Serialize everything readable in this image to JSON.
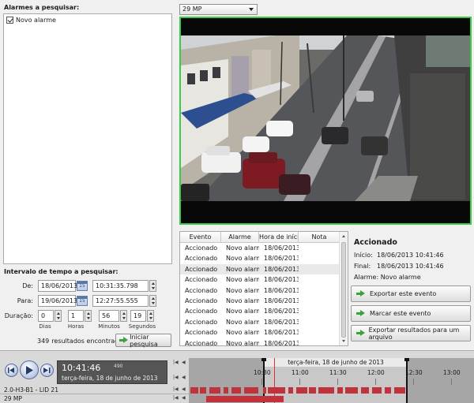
{
  "search": {
    "alarms_title": "Alarmes a pesquisar:",
    "alarms": [
      {
        "label": "Novo alarme",
        "checked": true
      }
    ],
    "interval_title": "Intervalo de tempo a pesquisar:",
    "from_label": "De:",
    "from_date": "18/06/2013",
    "from_time": "10:31:35.798",
    "to_label": "Para:",
    "to_date": "19/06/2013",
    "to_time": "12:27:55.555",
    "duration_label": "Duração:",
    "duration": {
      "days": "0",
      "hours": "1",
      "minutes": "56",
      "seconds": "19"
    },
    "units": {
      "days": "Dias",
      "hours": "Horas",
      "minutes": "Minutos",
      "seconds": "Segundos"
    },
    "results_count": "349",
    "results_label": "resultados encontrados",
    "start_search_label": "Iniciar pesquisa",
    "calendar_icon_text": "15"
  },
  "camera": {
    "selected": "29 MP"
  },
  "events_table": {
    "headers": [
      "Evento",
      "Alarme",
      "Hora de início",
      "Nota"
    ],
    "rows": [
      [
        "Accionado",
        "Novo alarm",
        "18/06/2013",
        ""
      ],
      [
        "Accionado",
        "Novo alarm",
        "18/06/2013",
        ""
      ],
      [
        "Accionado",
        "Novo alarm",
        "18/06/2013",
        ""
      ],
      [
        "Accionado",
        "Novo alarm",
        "18/06/2013",
        ""
      ],
      [
        "Accionado",
        "Novo alarm",
        "18/06/2013",
        ""
      ],
      [
        "Accionado",
        "Novo alarm",
        "18/06/2013",
        ""
      ],
      [
        "Accionado",
        "Novo alarm",
        "18/06/2013",
        ""
      ],
      [
        "Accionado",
        "Novo alarm",
        "18/06/2013",
        ""
      ],
      [
        "Accionado",
        "Novo alarm",
        "18/06/2013",
        ""
      ],
      [
        "Accionado",
        "Novo alarm",
        "18/06/2013",
        ""
      ]
    ],
    "selected_row": 2
  },
  "detail": {
    "title": "Accionado",
    "start_label": "Início:",
    "start_value": "18/06/2013 10:41:46",
    "end_label": "Final:",
    "end_value": "18/06/2013 10:41:46",
    "alarm_text": "Alarme: Novo alarme",
    "export_event": "Exportar este evento",
    "mark_event": "Marcar este evento",
    "export_results": "Exportar resultados para um arquivo"
  },
  "playback": {
    "time": "10:41:46",
    "ms": "490",
    "date": "terça-feira, 18 de junho de 2013",
    "timeline_date": "terça-feira, 18 de junho de 2013",
    "ticks": [
      "10:30",
      "11:00",
      "11:30",
      "12:00",
      "12:30",
      "13:00"
    ],
    "tracks": [
      "2.0-H3-B1 - LID 21",
      "29 MP"
    ]
  },
  "colors": {
    "video_border": "#3ec94a",
    "event_bar": "#c0323c",
    "accent_green": "#3aa43a"
  }
}
